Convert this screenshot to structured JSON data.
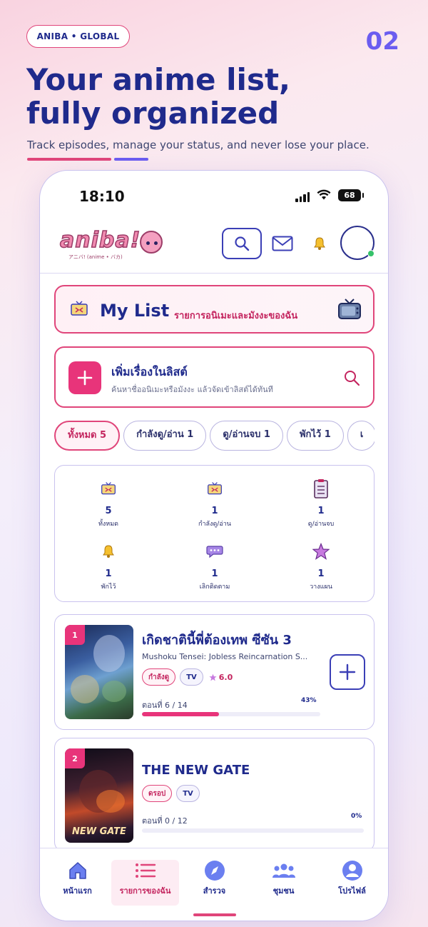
{
  "promo": {
    "brand": "ANIBA • GLOBAL",
    "page_number": "02",
    "headline_line1": "Your anime list,",
    "headline_line2": "fully organized",
    "subtitle": "Track episodes, manage your status, and never lose your place.",
    "accent_colors": [
      "#e0457a",
      "#6b5cf0"
    ]
  },
  "status_bar": {
    "time": "18:10",
    "battery": "68"
  },
  "header": {
    "logo_text": "aniba!",
    "logo_subtitle": "アニバ! (anime • バカ)",
    "search_icon": "search-icon",
    "mail_icon": "mail-icon",
    "bell_icon": "bell-icon",
    "online_status_color": "#36c26a"
  },
  "mylist": {
    "title": "My List",
    "subtitle": "รายการอนิเมะและมังงะของฉัน"
  },
  "add_entry": {
    "title": "เพิ่มเรื่องในลิสต์",
    "subtitle": "ค้นหาชื่ออนิเมะหรือมังงะ แล้วจัดเข้าลิสต์ได้ทันที"
  },
  "filters": [
    {
      "label": "ทั้งหมด 5",
      "active": true
    },
    {
      "label": "กำลังดู/อ่าน 1",
      "active": false
    },
    {
      "label": "ดู/อ่านจบ 1",
      "active": false
    },
    {
      "label": "พักไว้ 1",
      "active": false
    },
    {
      "label": "เ",
      "active": false
    }
  ],
  "stats": [
    {
      "icon": "tv-icon",
      "value": "5",
      "label": "ทั้งหมด"
    },
    {
      "icon": "tv-icon",
      "value": "1",
      "label": "กำลังดู/อ่าน"
    },
    {
      "icon": "clipboard-icon",
      "value": "1",
      "label": "ดู/อ่านจบ"
    },
    {
      "icon": "bell-icon",
      "value": "1",
      "label": "พักไว้"
    },
    {
      "icon": "chat-icon",
      "value": "1",
      "label": "เลิกติดตาม"
    },
    {
      "icon": "star-icon",
      "value": "1",
      "label": "วางแผน"
    }
  ],
  "entries": [
    {
      "rank": "1",
      "title": "เกิดชาตินี้พี่ต้องเทพ ซีซัน 3",
      "subtitle": "Mushoku Tensei: Jobless Reincarnation S...",
      "status": "กำลังดู",
      "type": "TV",
      "rating": "6.0",
      "episode": "ตอนที่ 6 / 14",
      "percent_label": "43%",
      "progress": 0.43
    },
    {
      "rank": "2",
      "title": "THE NEW GATE",
      "subtitle": "",
      "status": "ดรอป",
      "type": "TV",
      "rating": "",
      "episode": "ตอนที่ 0 / 12",
      "percent_label": "0%",
      "progress": 0,
      "poster_text": "NEW GATE"
    }
  ],
  "tabs": [
    {
      "icon": "home-icon",
      "label": "หน้าแรก",
      "active": false
    },
    {
      "icon": "list-icon",
      "label": "รายการของฉัน",
      "active": true
    },
    {
      "icon": "compass-icon",
      "label": "สำรวจ",
      "active": false
    },
    {
      "icon": "community-icon",
      "label": "ชุมชน",
      "active": false
    },
    {
      "icon": "profile-icon",
      "label": "โปรไฟล์",
      "active": false
    }
  ]
}
